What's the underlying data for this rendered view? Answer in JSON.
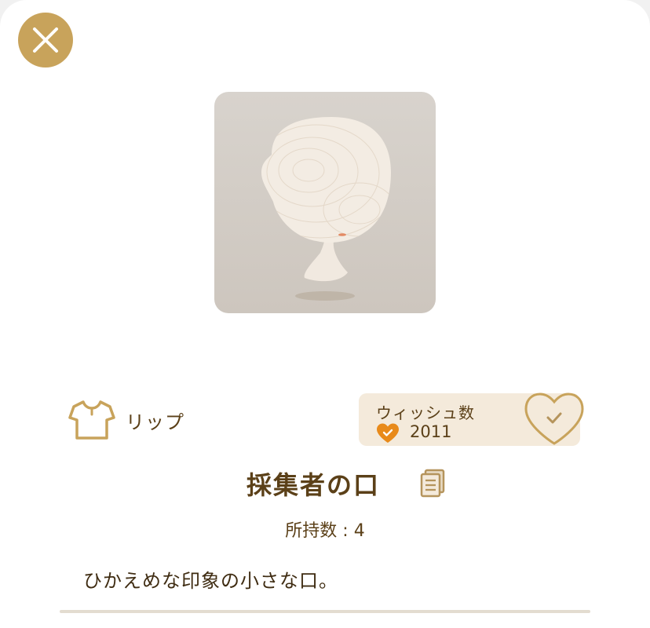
{
  "header": {
    "close_icon": "close-icon"
  },
  "preview": {
    "icon": "mannequin-head-preview",
    "accent_color": "#e38a64"
  },
  "item": {
    "category_icon": "shirt-icon",
    "category": "リップ",
    "name": "採集者の口",
    "owned_label": "所持数",
    "owned_separator": " : ",
    "owned_count": "4",
    "description": "ひかえめな印象の小さな口。"
  },
  "wishlist": {
    "title": "ウィッシュ数",
    "count": "2011",
    "heart_color": "#e88a1a",
    "button_icon": "heart-check-icon"
  },
  "colors": {
    "accent_gold": "#c8a35b",
    "text_brown": "#5b4018",
    "wish_bg": "#f4eadb"
  }
}
